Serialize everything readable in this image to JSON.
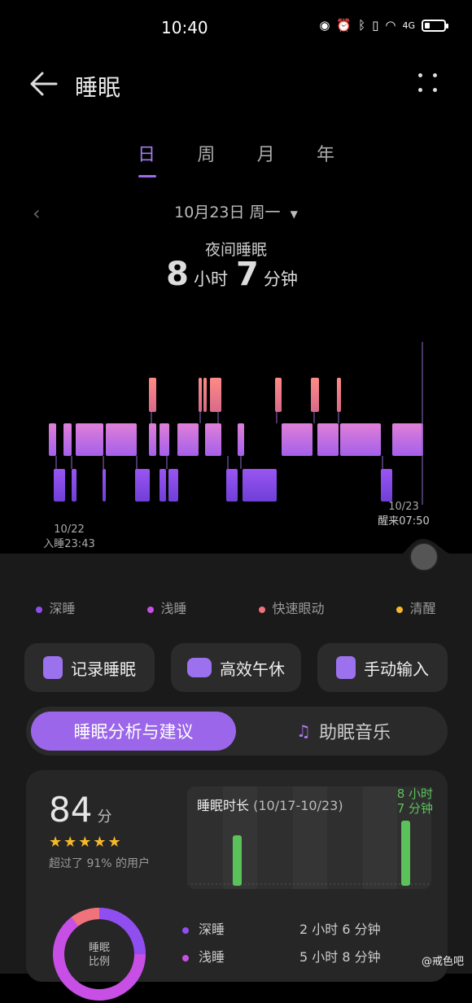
{
  "status_bar": {
    "time": "10:40",
    "net": "4G",
    "battery_level": 0.25
  },
  "header": {
    "title": "睡眠"
  },
  "tabs": [
    "日",
    "周",
    "月",
    "年"
  ],
  "active_tab": 0,
  "date": {
    "text": "10月23日 周一"
  },
  "summary": {
    "label": "夜间睡眠",
    "hours": "8",
    "hours_unit": "小时",
    "minutes": "7",
    "minutes_unit": "分钟"
  },
  "chart": {
    "start_date": "10/22",
    "start_label": "入睡23:43",
    "end_date": "10/23",
    "end_label": "醒来07:50"
  },
  "legend": [
    {
      "label": "深睡",
      "color": "#8f4ef0"
    },
    {
      "label": "浅睡",
      "color": "#c84fe6"
    },
    {
      "label": "快速眼动",
      "color": "#f0727a"
    },
    {
      "label": "清醒",
      "color": "#f5b82a"
    }
  ],
  "actions": [
    {
      "label": "记录睡眠"
    },
    {
      "label": "高效午休"
    },
    {
      "label": "手动输入"
    }
  ],
  "segment": {
    "active": "睡眠分析与建议",
    "inactive": "助眠音乐"
  },
  "score": {
    "value": "84",
    "unit": "分",
    "rating": 4.5,
    "stars": "★★★★★",
    "beat": "超过了 91% 的用户"
  },
  "mini_chart": {
    "title": "睡眠时长",
    "range": "(10/17-10/23)",
    "value_line1": "8 小时",
    "value_line2": "7 分钟"
  },
  "ratio": {
    "label_line1": "睡眠",
    "label_line2": "比例",
    "rows": [
      {
        "label": "深睡",
        "value": "2 小时 6 分钟",
        "color": "#8f4ef0"
      },
      {
        "label": "浅睡",
        "value": "5 小时 8 分钟",
        "color": "#c84fe6"
      }
    ]
  },
  "watermark": "@戒色吧"
}
